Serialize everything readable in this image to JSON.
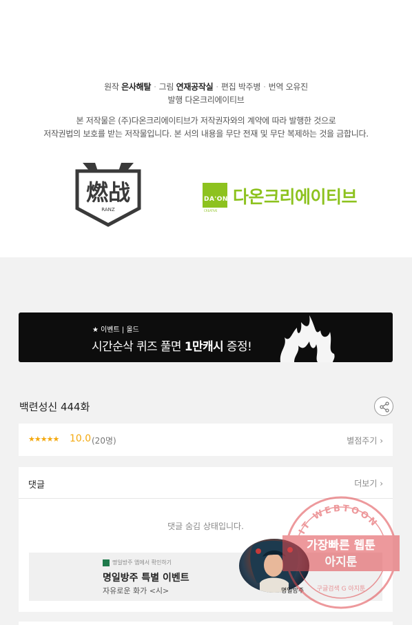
{
  "credits": {
    "original_label": "원작",
    "original_name": "은사해탈",
    "art_label": "그림",
    "art_name": "연재공작실",
    "editor_label": "편집",
    "editor_name": "박주병",
    "translator_label": "번역",
    "translator_name": "오유진",
    "publisher_line": "발행 다온크리에이티브",
    "copyright_1": "본 저작물은 (주)다온크리에이티브가 저작권자와의 계약에 따라 발행한 것으로",
    "copyright_2": "저작권법의 보호를 받는 저작물입니다. 본 서의 내용을 무단 전재 및 무단 복제하는 것을 금합니다."
  },
  "logos": {
    "left_text": "燃战",
    "left_sub": "RANZ",
    "right_box": "DA'ON",
    "right_box_sub": "CREATIVE",
    "right_name": "다온크리에이티브"
  },
  "banner": {
    "tag": "★ 이벤트 | 올드",
    "headline_pre": "시간순삭 퀴즈 풀면 ",
    "headline_bold": "1만캐시",
    "headline_post": " 증정!"
  },
  "episode": {
    "title": "백련성신 444화",
    "share_icon": "share-icon"
  },
  "rating": {
    "stars": "★★★★★",
    "score": "10.0",
    "count": "(20명)",
    "rate_link": "별점주기 ›"
  },
  "comments": {
    "title": "댓글",
    "more": "더보기 ›",
    "hidden_message": "댓글 숨김 상태입니다.",
    "ad": {
      "sponsor": "명일방주 앱에서 확인하기",
      "title": "명일방주 특별 이벤트",
      "subtitle": "자유로운 화가 <시>",
      "portrait_caption": "명일방주"
    }
  },
  "watermark": {
    "ring_text": "AGIT WEBTOON",
    "line_1": "가장빠른 웹툰",
    "line_2": "아지툰",
    "bottom": "구글검색 G 아지툰"
  },
  "colors": {
    "accent_green": "#8dc21f",
    "star_orange": "#f4a90f",
    "watermark_red": "#e0474c"
  }
}
